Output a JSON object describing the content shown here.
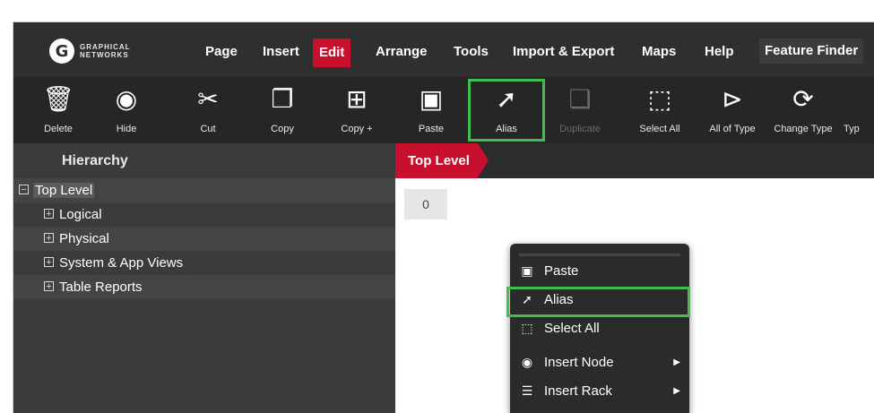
{
  "logo": {
    "mark": "G",
    "line1": "GRAPHICAL",
    "line2": "NETWORKS"
  },
  "menu": {
    "items": [
      {
        "label": "Page"
      },
      {
        "label": "Insert"
      },
      {
        "label": "Edit"
      },
      {
        "label": "Arrange"
      },
      {
        "label": "Tools"
      },
      {
        "label": "Import & Export"
      },
      {
        "label": "Maps"
      },
      {
        "label": "Help"
      }
    ],
    "active": "Edit",
    "feature_finder": "Feature Finder"
  },
  "toolbar": {
    "tools": [
      {
        "label": "Delete",
        "icon": "trash-icon"
      },
      {
        "label": "Hide",
        "icon": "eye-icon"
      },
      {
        "label": "Cut",
        "icon": "scissors-icon"
      },
      {
        "label": "Copy",
        "icon": "copy-icon"
      },
      {
        "label": "Copy +",
        "icon": "copy-plus-icon"
      },
      {
        "label": "Paste",
        "icon": "paste-icon"
      },
      {
        "label": "Alias",
        "icon": "alias-arrow-icon"
      },
      {
        "label": "Duplicate",
        "icon": "duplicate-icon",
        "disabled": true
      },
      {
        "label": "Select All",
        "icon": "select-all-icon"
      },
      {
        "label": "All of Type",
        "icon": "all-of-type-icon"
      },
      {
        "label": "Change Type",
        "icon": "change-type-icon"
      },
      {
        "label": "Typ",
        "icon": ""
      }
    ],
    "highlight_color": "#3fbf4f"
  },
  "sidebar": {
    "header": "Hierarchy",
    "tree": [
      {
        "label": "Top Level",
        "expander": "−",
        "selected": true
      },
      {
        "label": "Logical",
        "expander": "+"
      },
      {
        "label": "Physical",
        "expander": "+"
      },
      {
        "label": "System & App Views",
        "expander": "+"
      },
      {
        "label": "Table Reports",
        "expander": "+"
      }
    ]
  },
  "main": {
    "tab": "Top Level",
    "badge": "0"
  },
  "context_menu": {
    "items": [
      {
        "label": "Paste",
        "icon": "paste-icon"
      },
      {
        "label": "Alias",
        "icon": "alias-arrow-icon"
      },
      {
        "label": "Select All",
        "icon": "select-all-icon"
      },
      {
        "label": "Insert Node",
        "icon": "node-icon",
        "submenu": true
      },
      {
        "label": "Insert Rack",
        "icon": "rack-icon",
        "submenu": true
      }
    ]
  },
  "colors": {
    "accent": "#c8102e",
    "highlight": "#3fbf4f",
    "bar": "#2f2f2f"
  }
}
